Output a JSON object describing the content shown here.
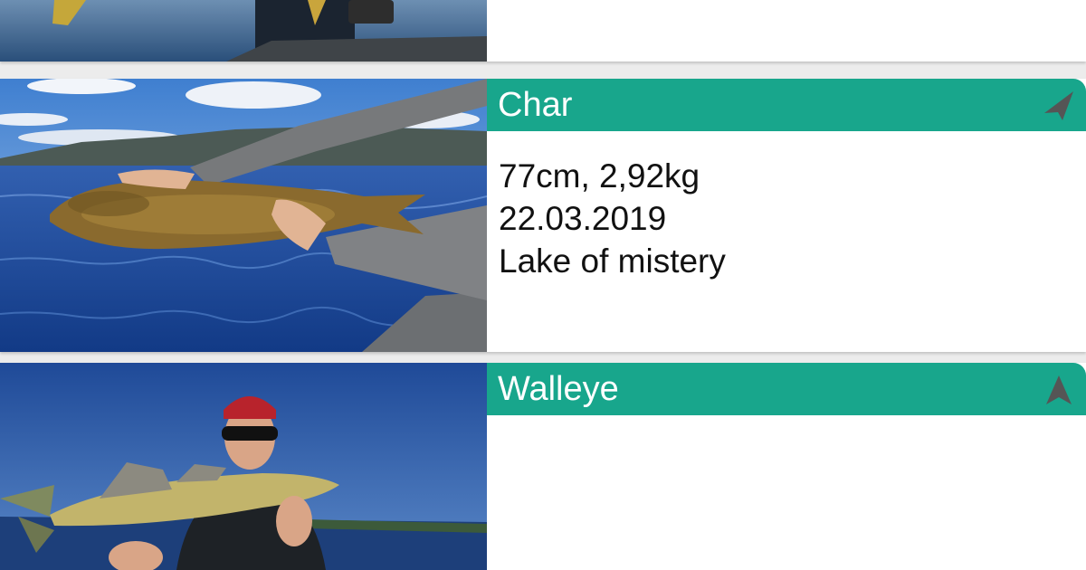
{
  "catches": [
    {
      "species": "",
      "details": []
    },
    {
      "species": "Char",
      "details": [
        "77cm, 2,92kg",
        "22.03.2019",
        "Lake of mistery"
      ],
      "nav_icon": "navigation-arrow-icon"
    },
    {
      "species": "Walleye",
      "details": [],
      "nav_icon": "navigation-arrow-icon"
    }
  ],
  "colors": {
    "accent": "#18a68c",
    "card_background": "#ffffff",
    "list_background": "#ececec",
    "nav_icon": "#555555"
  }
}
